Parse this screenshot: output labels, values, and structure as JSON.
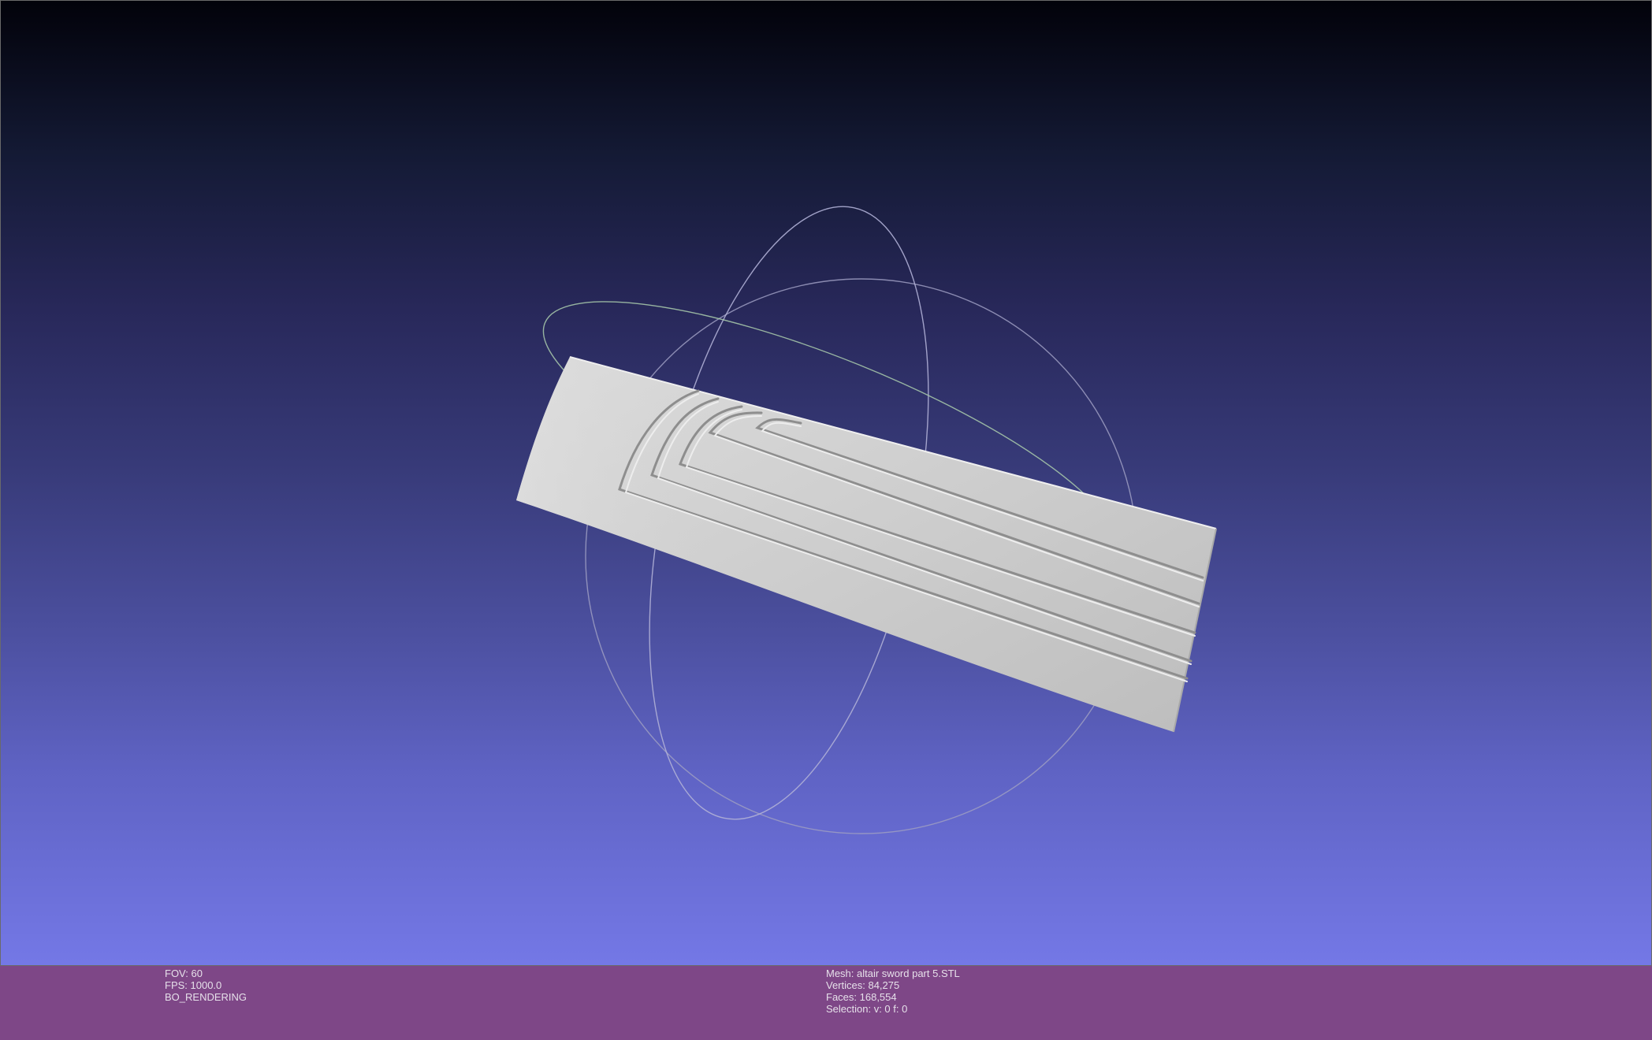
{
  "render_info": {
    "fov": "FOV: 60",
    "fps": "FPS:  1000.0",
    "mode": "BO_RENDERING"
  },
  "mesh_info": {
    "mesh": "Mesh: altair sword part 5.STL",
    "vertices": "Vertices: 84,275",
    "faces": "Faces: 168,554",
    "selection": "Selection: v: 0 f: 0"
  },
  "colors": {
    "bar": "#7e4787",
    "mesh": "#cfcfcf",
    "trackball": "#a8a8c8"
  }
}
